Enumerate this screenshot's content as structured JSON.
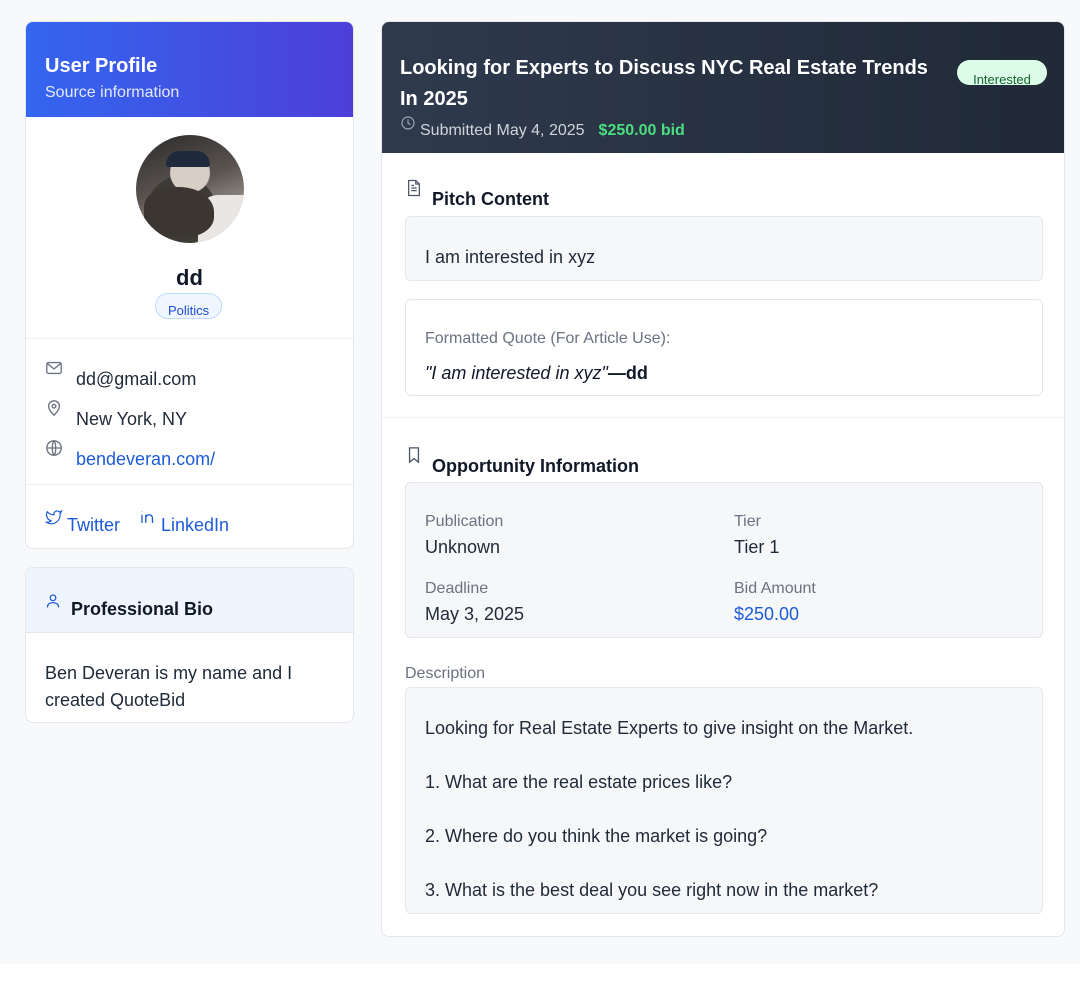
{
  "profile": {
    "header_title": "User Profile",
    "header_subtitle": "Source information",
    "name": "dd",
    "category": "Politics",
    "email": "dd@gmail.com",
    "location": "New York, NY",
    "website": "bendeveran.com/",
    "social": {
      "twitter": "Twitter",
      "linkedin": "LinkedIn"
    }
  },
  "bio": {
    "title": "Professional Bio",
    "text": "Ben Deveran is my name and I created QuoteBid"
  },
  "opportunity": {
    "title": "Looking for Experts to Discuss NYC Real Estate Trends In 2025",
    "status": "Interested",
    "submitted": "Submitted May 4, 2025",
    "bid": "$250.00 bid"
  },
  "pitch": {
    "section_title": "Pitch Content",
    "content": "I am interested in xyz",
    "formatted_label": "Formatted Quote (For Article Use):",
    "formatted_quote": "\"I am interested in xyz\"",
    "formatted_attribution": "—dd"
  },
  "info": {
    "section_title": "Opportunity Information",
    "publication_label": "Publication",
    "publication_value": "Unknown",
    "tier_label": "Tier",
    "tier_value": "Tier 1",
    "deadline_label": "Deadline",
    "deadline_value": "May 3, 2025",
    "bid_label": "Bid Amount",
    "bid_value": "$250.00"
  },
  "description": {
    "label": "Description",
    "lines": [
      "Looking for Real Estate Experts to give insight on the Market.",
      "1. What are the real estate prices like?",
      "2. Where do you think the market is going?",
      "3. What is the best deal you see right now in the market?"
    ]
  },
  "colors": {
    "profile_gradient_start": "#3466f0",
    "profile_gradient_end": "#4c3fd8",
    "header_dark": "#1f2937",
    "link_blue": "#1d5bd8",
    "bid_green": "#4ade80",
    "status_bg": "#dcfce7"
  },
  "icons": [
    "mail-icon",
    "map-pin-icon",
    "globe-icon",
    "twitter-icon",
    "linkedin-icon",
    "user-icon",
    "clock-icon",
    "document-icon",
    "bookmark-icon"
  ]
}
